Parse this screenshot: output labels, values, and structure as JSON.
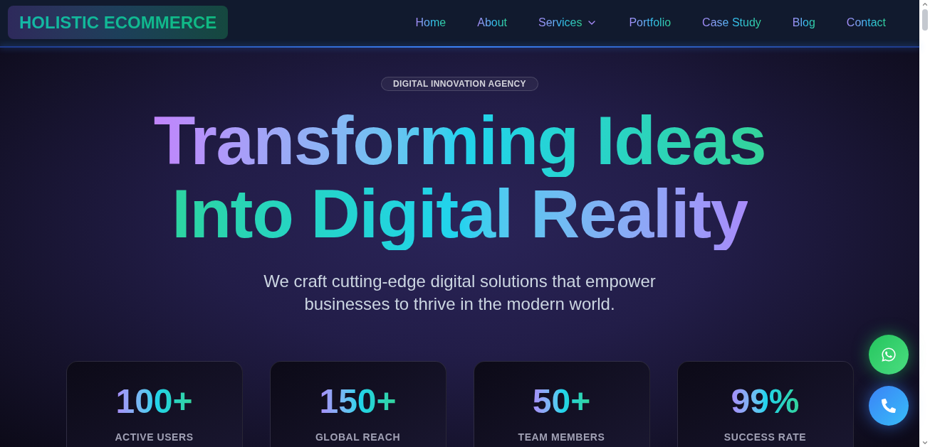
{
  "header": {
    "logo": "HOLISTIC ECOMMERCE",
    "nav": [
      {
        "label": "Home",
        "kind": "link"
      },
      {
        "label": "About",
        "kind": "link"
      },
      {
        "label": "Services",
        "kind": "dropdown"
      },
      {
        "label": "Portfolio",
        "kind": "link"
      },
      {
        "label": "Case Study",
        "kind": "link"
      },
      {
        "label": "Blog",
        "kind": "link"
      },
      {
        "label": "Contact",
        "kind": "link"
      }
    ]
  },
  "hero": {
    "badge": "DIGITAL INNOVATION AGENCY",
    "heading_lines": [
      "Transforming Ideas",
      "Into Digital Reality"
    ],
    "subtitle": "We craft cutting-edge digital solutions that empower businesses to thrive in the modern world.",
    "stats": [
      {
        "value": "100+",
        "label": "ACTIVE USERS"
      },
      {
        "value": "150+",
        "label": "GLOBAL REACH"
      },
      {
        "value": "50+",
        "label": "TEAM MEMBERS"
      },
      {
        "value": "99%",
        "label": "SUCCESS RATE"
      }
    ]
  },
  "floating_buttons": [
    {
      "kind": "whatsapp"
    },
    {
      "kind": "phone"
    }
  ]
}
